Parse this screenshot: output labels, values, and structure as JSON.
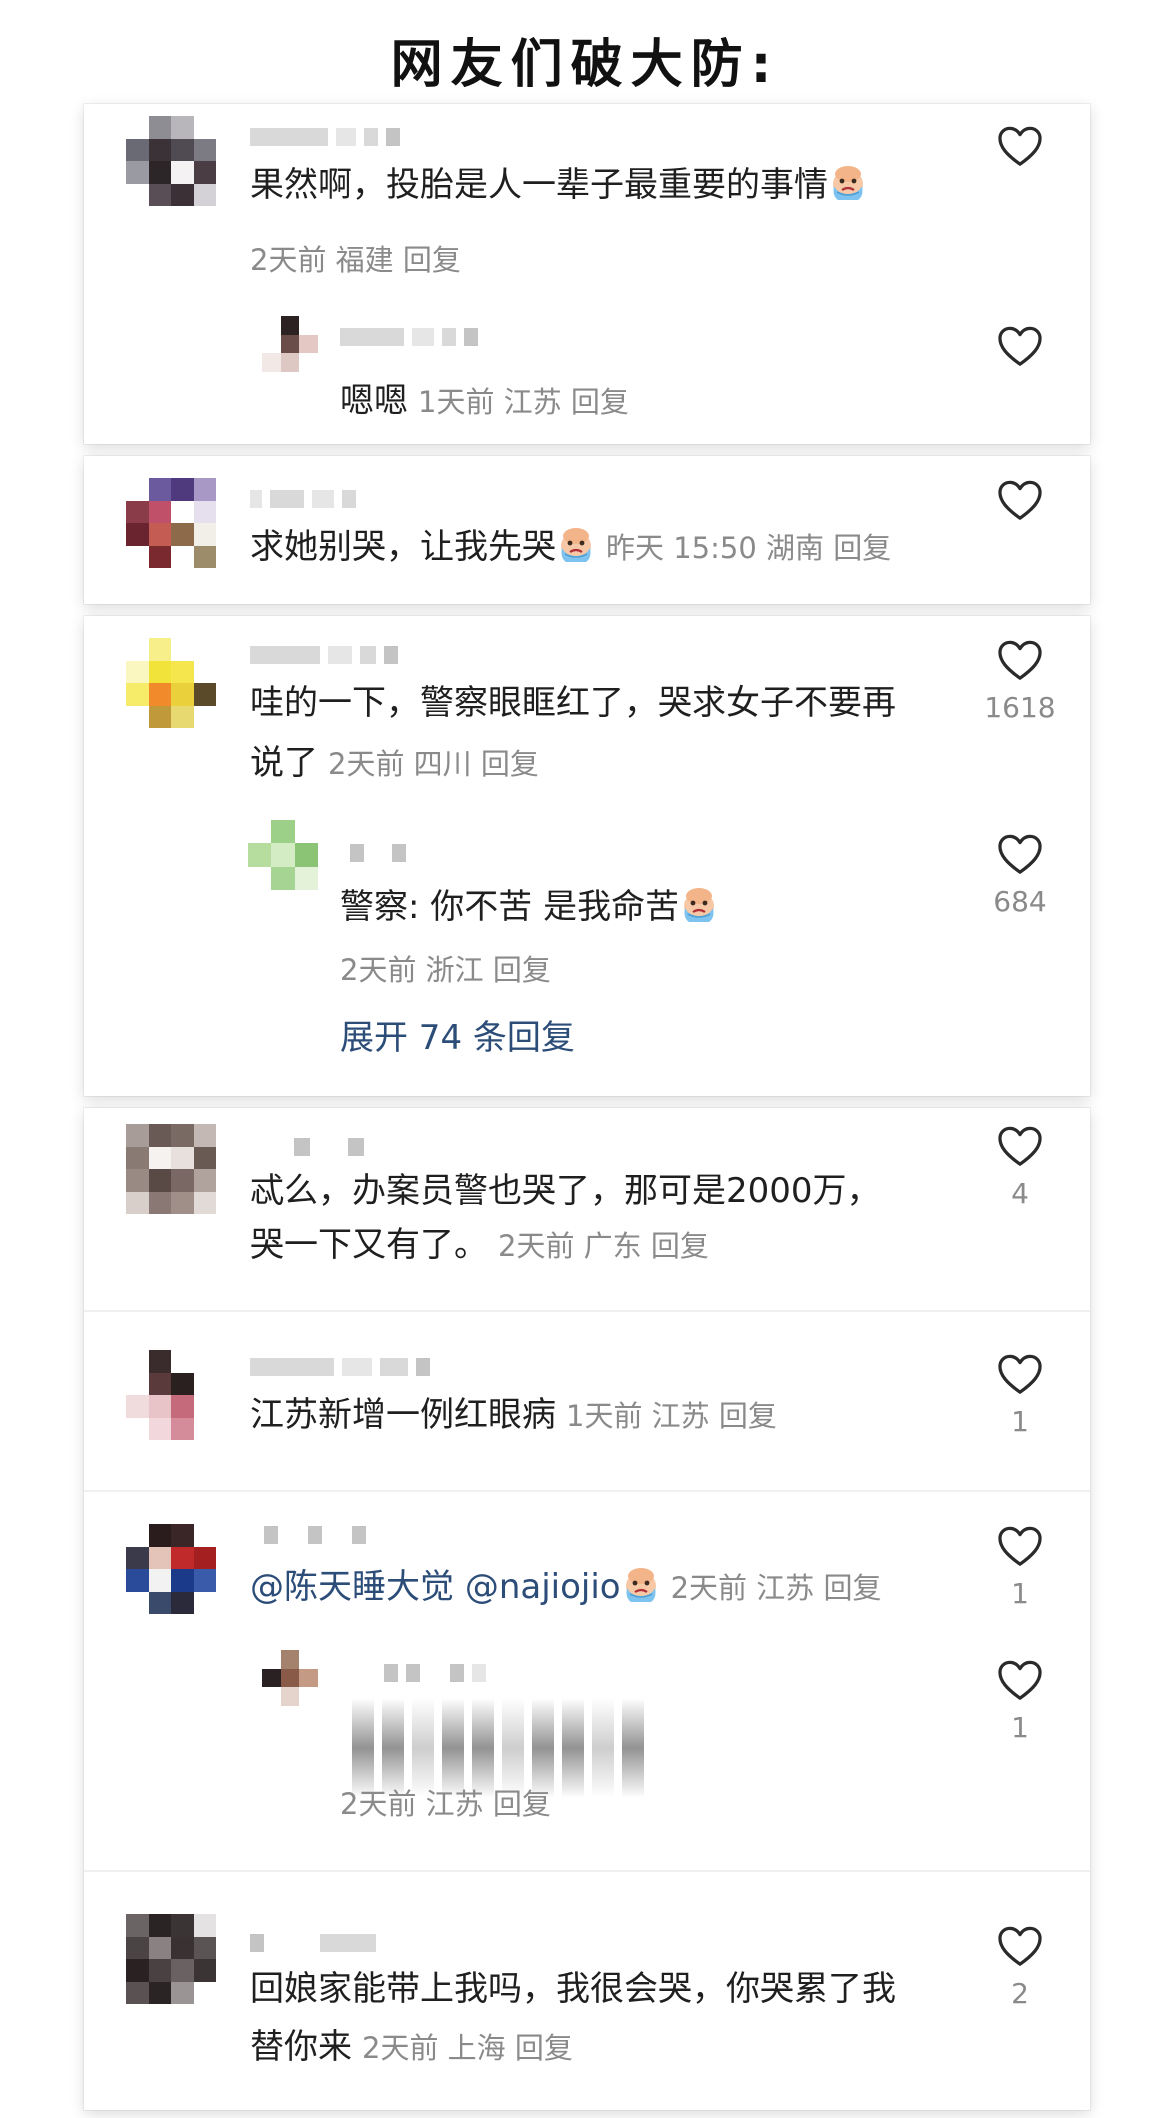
{
  "page": {
    "title": "网友们破大防:"
  },
  "threads": [
    {
      "comments": [
        {
          "text": "果然啊，投胎是人一辈子最重要的事情",
          "emoji": "crying-face-emoji",
          "meta": "2天前 福建 回复",
          "likes": "",
          "replies": [
            {
              "text": "嗯嗯",
              "meta": "1天前 江苏 回复",
              "likes": ""
            }
          ]
        }
      ]
    },
    {
      "comments": [
        {
          "text": "求她别哭，让我先哭",
          "emoji": "crying-face-emoji",
          "meta": "昨天 15:50 湖南 回复",
          "likes": "",
          "replies": []
        }
      ]
    },
    {
      "comments": [
        {
          "text_line1": "哇的一下，警察眼眶红了，哭求女子不要再",
          "text_line2": "说了",
          "meta": "2天前 四川 回复",
          "likes": "1618",
          "replies": [
            {
              "text": "警察: 你不苦 是我命苦",
              "emoji": "crying-face-emoji",
              "meta": "2天前 浙江 回复",
              "likes": "684"
            }
          ],
          "expand_label": "展开 74 条回复"
        }
      ]
    },
    {
      "comments": [
        {
          "text_line1": "忒么，办案员警也哭了，那可是2000万，",
          "text_line2": "哭一下又有了。",
          "meta": "2天前 广东 回复",
          "likes": "4",
          "replies": []
        },
        {
          "text": "江苏新增一例红眼病",
          "meta": "1天前 江苏 回复",
          "likes": "1",
          "replies": []
        },
        {
          "mention1": "@陈天睡大觉",
          "mention2": "@najiojio",
          "emoji": "crying-face-emoji",
          "meta": "2天前 江苏 回复",
          "likes": "1",
          "replies": [
            {
              "text": "",
              "meta": "2天前 江苏 回复",
              "likes": "1"
            }
          ]
        },
        {
          "text_line1": "回娘家能带上我吗，我很会哭，你哭累了我",
          "text_line2": "替你来",
          "meta": "2天前 上海 回复",
          "likes": "2",
          "replies": []
        }
      ]
    }
  ],
  "icons": {
    "like": "heart-outline-icon",
    "emoji": "crying-face-emoji"
  },
  "colors": {
    "link": "#2d4d79",
    "meta": "#8a8a8a",
    "text": "#1f1f1f"
  }
}
